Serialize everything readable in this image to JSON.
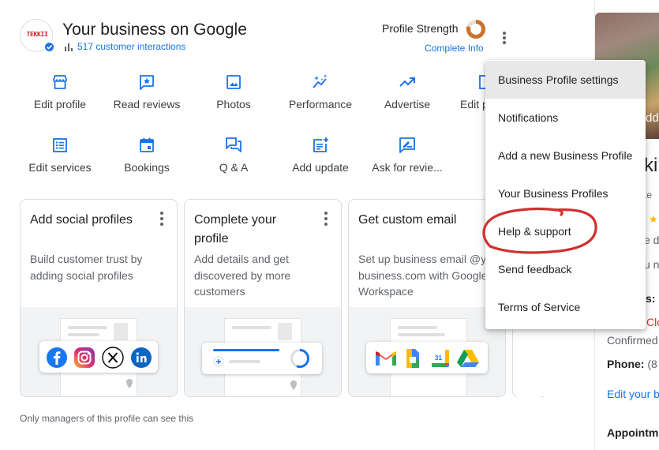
{
  "header": {
    "logo_text": "TEKKII",
    "title": "Your business on Google",
    "interactions": "517 customer interactions",
    "profile_strength_label": "Profile Strength",
    "complete_info": "Complete Info",
    "profile_strength_fraction": 0.8
  },
  "actions": [
    {
      "label": "Edit profile",
      "icon": "storefront-icon"
    },
    {
      "label": "Read reviews",
      "icon": "review-star-icon"
    },
    {
      "label": "Photos",
      "icon": "photo-icon"
    },
    {
      "label": "Performance",
      "icon": "performance-sparkle-icon"
    },
    {
      "label": "Advertise",
      "icon": "trending-up-icon"
    },
    {
      "label": "Edit p",
      "icon": "edit-products-icon"
    },
    {
      "label": "Edit services",
      "icon": "list-icon"
    },
    {
      "label": "Bookings",
      "icon": "calendar-icon"
    },
    {
      "label": "Q & A",
      "icon": "forum-icon"
    },
    {
      "label": "Add update",
      "icon": "post-add-icon"
    },
    {
      "label": "Ask for revie...",
      "icon": "rate-review-icon"
    }
  ],
  "cards": [
    {
      "title": "Add social profiles",
      "description": "Build customer trust by adding social profiles",
      "icons": [
        "facebook-icon",
        "instagram-icon",
        "x-icon",
        "linkedin-icon"
      ]
    },
    {
      "title": "Complete your profile",
      "description": "Add details and get discovered by more customers"
    },
    {
      "title": "Get custom email",
      "description": "Set up business email @your-business.com with Google Workspace",
      "icons": [
        "gmail-icon",
        "docs-icon",
        "calendar-icon",
        "drive-icon"
      ]
    }
  ],
  "footnote": "Only managers of this profile can see this",
  "menu": {
    "items": [
      "Business Profile settings",
      "Notifications",
      "Add a new Business Profile",
      "Your Business Profiles",
      "Help & support",
      "Send feedback",
      "Terms of Service"
    ],
    "highlighted": "Help & support",
    "highlight_color": "#d32f2f"
  },
  "right_panel": {
    "photo_caption": "dd",
    "name_fragment": "kii",
    "tab_fragment": "te",
    "rating_fragment": "★",
    "line1": "e de",
    "line2": "u n",
    "hours_label": "s:",
    "hours_status": "Clo",
    "confirmed": "Confirmed",
    "phone_label": "Phone:",
    "phone_value": "(8",
    "edit_link": "Edit your b",
    "appointments": "Appointm"
  },
  "colors": {
    "accent": "#1a73e8",
    "strength_ring": "#c8732a"
  }
}
